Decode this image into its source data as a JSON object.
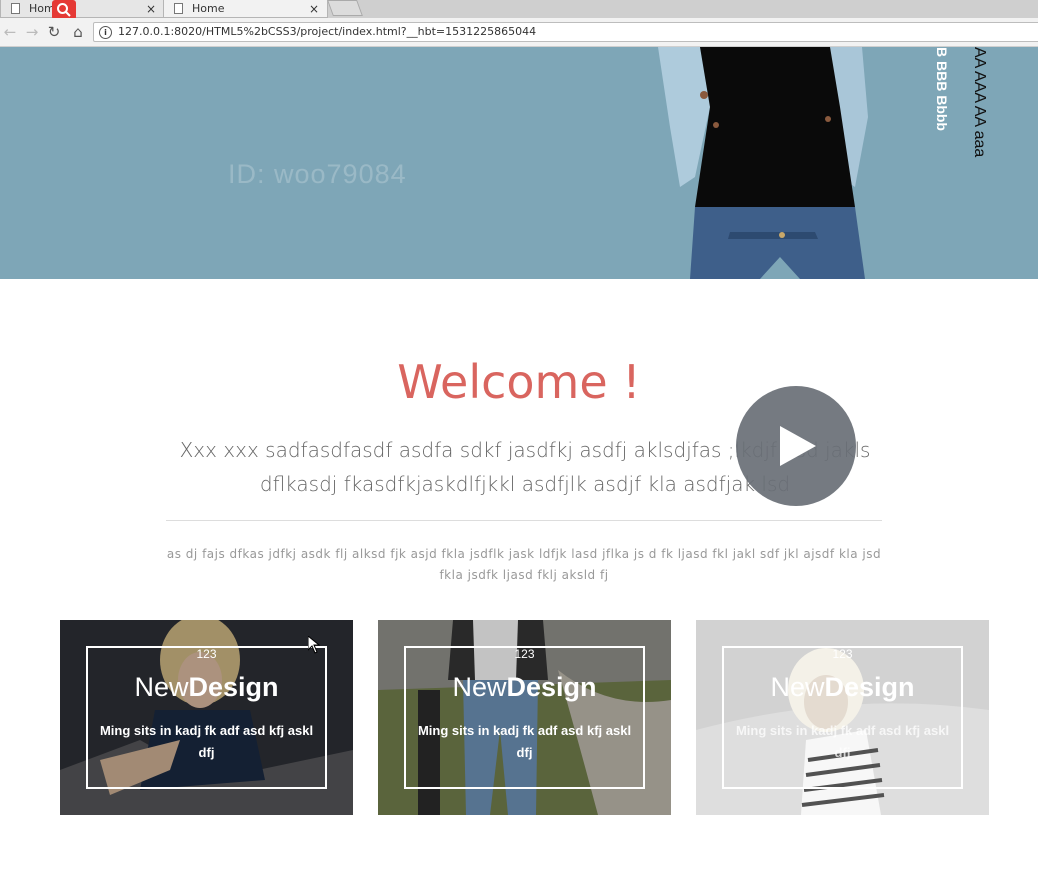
{
  "browser": {
    "tabs": [
      {
        "title": "Home",
        "close": "×"
      },
      {
        "title": "Home",
        "close": "×"
      }
    ],
    "url": "127.0.0.1:8020/HTML5%2bCSS3/project/index.html?__hbt=1531225865044",
    "nav": {
      "back": "←",
      "forward": "→",
      "reload": "↻",
      "home": "⌂",
      "info": "i"
    }
  },
  "hero": {
    "watermark": "ID: woo79084",
    "vertical_white": "B BBB Bbbb",
    "vertical_black": "AA AAA AA aaa",
    "background": "#7ea6b7"
  },
  "intro": {
    "title": "Welcome !",
    "lead": "Xxx xxx sadfasdfasdf asdfa sdkf jasdfkj asdfj aklsdjfas ;lkdjf asd jakls dflkasdj fkasdfkjaskdlfjkkl asdfjlk asdjf kla asdfjak lsd",
    "small": "as dj fajs dfkas jdfkj asdk flj alksd fjk asjd fkla jsdflk jask ldfjk lasd jflka js d fk ljasd fkl jakl sdf jkl ajsdf kla jsd fkla jsdfk ljasd fklj aksld fj",
    "title_color": "#d9655f"
  },
  "cards": [
    {
      "number": "123",
      "heading_light": "New",
      "heading_bold": "Design",
      "description": "Ming sits in kadj fk adf asd kfj askl dfj"
    },
    {
      "number": "123",
      "heading_light": "New",
      "heading_bold": "Design",
      "description": "Ming sits in kadj fk adf asd kfj askl dfj"
    },
    {
      "number": "123",
      "heading_light": "New",
      "heading_bold": "Design",
      "description": "Ming sits in kadj fk adf asd kfj askl dfj"
    }
  ]
}
